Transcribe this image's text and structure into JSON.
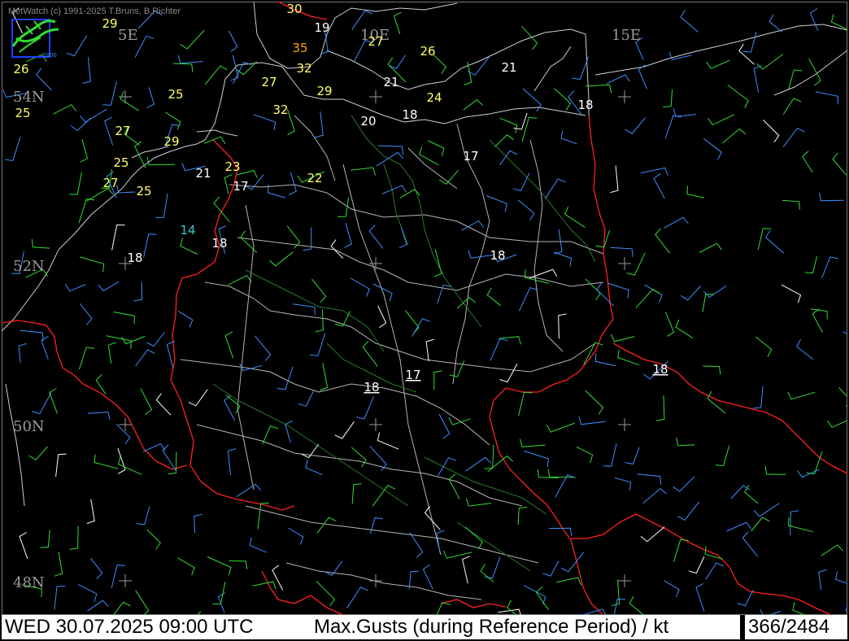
{
  "credit": "MetWatch  (c) 1991-2025 T.Bruns, B.Richter",
  "logo": {
    "icon": "metwatch-logo-icon",
    "text": "2000"
  },
  "coordinate_labels": [
    {
      "id": "5e",
      "text": "5E"
    },
    {
      "id": "10e",
      "text": "10E"
    },
    {
      "id": "15e",
      "text": "15E"
    },
    {
      "id": "54n",
      "text": "54N"
    },
    {
      "id": "52n",
      "text": "52N"
    },
    {
      "id": "50n",
      "text": "50N"
    },
    {
      "id": "48n",
      "text": "48N"
    }
  ],
  "gust_values": [
    {
      "id": "g30",
      "value": "30",
      "color": "#ffff66"
    },
    {
      "id": "g19",
      "value": "19",
      "color": "#ffffff"
    },
    {
      "id": "g35",
      "value": "35",
      "color": "#ffa500"
    },
    {
      "id": "g27a",
      "value": "27",
      "color": "#ffff66"
    },
    {
      "id": "g26",
      "value": "26",
      "color": "#ffff66"
    },
    {
      "id": "g32a",
      "value": "32",
      "color": "#ffff66"
    },
    {
      "id": "g27b",
      "value": "27",
      "color": "#ffff66"
    },
    {
      "id": "g29a",
      "value": "29",
      "color": "#ffff66"
    },
    {
      "id": "g21a",
      "value": "21",
      "color": "#ffffff"
    },
    {
      "id": "g21b",
      "value": "21",
      "color": "#ffffff"
    },
    {
      "id": "g29b",
      "value": "29",
      "color": "#ffff66"
    },
    {
      "id": "g26b",
      "value": "26",
      "color": "#ffff66"
    },
    {
      "id": "g25a",
      "value": "25",
      "color": "#ffff66"
    },
    {
      "id": "g25b",
      "value": "25",
      "color": "#ffff66"
    },
    {
      "id": "g32b",
      "value": "32",
      "color": "#ffff66"
    },
    {
      "id": "g24",
      "value": "24",
      "color": "#ffff66"
    },
    {
      "id": "g18a",
      "value": "18",
      "color": "#ffffff"
    },
    {
      "id": "g18b",
      "value": "18",
      "color": "#ffffff"
    },
    {
      "id": "g20",
      "value": "20",
      "color": "#ffffff"
    },
    {
      "id": "g27c",
      "value": "27",
      "color": "#ffff66"
    },
    {
      "id": "g29c",
      "value": "29",
      "color": "#ffff66"
    },
    {
      "id": "g17a",
      "value": "17",
      "color": "#ffffff"
    },
    {
      "id": "g25c",
      "value": "25",
      "color": "#ffff66"
    },
    {
      "id": "g21c",
      "value": "21",
      "color": "#ffffff"
    },
    {
      "id": "g23",
      "value": "23",
      "color": "#ffff66"
    },
    {
      "id": "g22",
      "value": "22",
      "color": "#ffff66"
    },
    {
      "id": "g27d",
      "value": "27",
      "color": "#ffff66"
    },
    {
      "id": "g25d",
      "value": "25",
      "color": "#ffff66"
    },
    {
      "id": "g17b",
      "value": "17",
      "color": "#ffffff"
    },
    {
      "id": "g14",
      "value": "14",
      "color": "#33cccc"
    },
    {
      "id": "g18c",
      "value": "18",
      "color": "#ffffff"
    },
    {
      "id": "g18d",
      "value": "18",
      "color": "#ffffff"
    },
    {
      "id": "g18e",
      "value": "18",
      "color": "#ffffff"
    },
    {
      "id": "g18f",
      "value": "18",
      "color": "#ffffff",
      "underline": true
    },
    {
      "id": "g17c",
      "value": "17",
      "color": "#ffffff",
      "underline": true
    },
    {
      "id": "g18g",
      "value": "18",
      "color": "#ffffff",
      "underline": true
    }
  ],
  "legend_colors": {
    "border": "#ff2020",
    "state_border": "#bdbdbd",
    "river": "#2e8b2e",
    "barb_green": "#33dd33",
    "barb_blue": "#3f8fff",
    "barb_white": "#ffffff"
  },
  "status": {
    "datetime": "WED 30.07.2025 09:00 UTC",
    "parameter": "Max.Gusts (during Reference Period) / kt",
    "counter": "366/2484"
  }
}
